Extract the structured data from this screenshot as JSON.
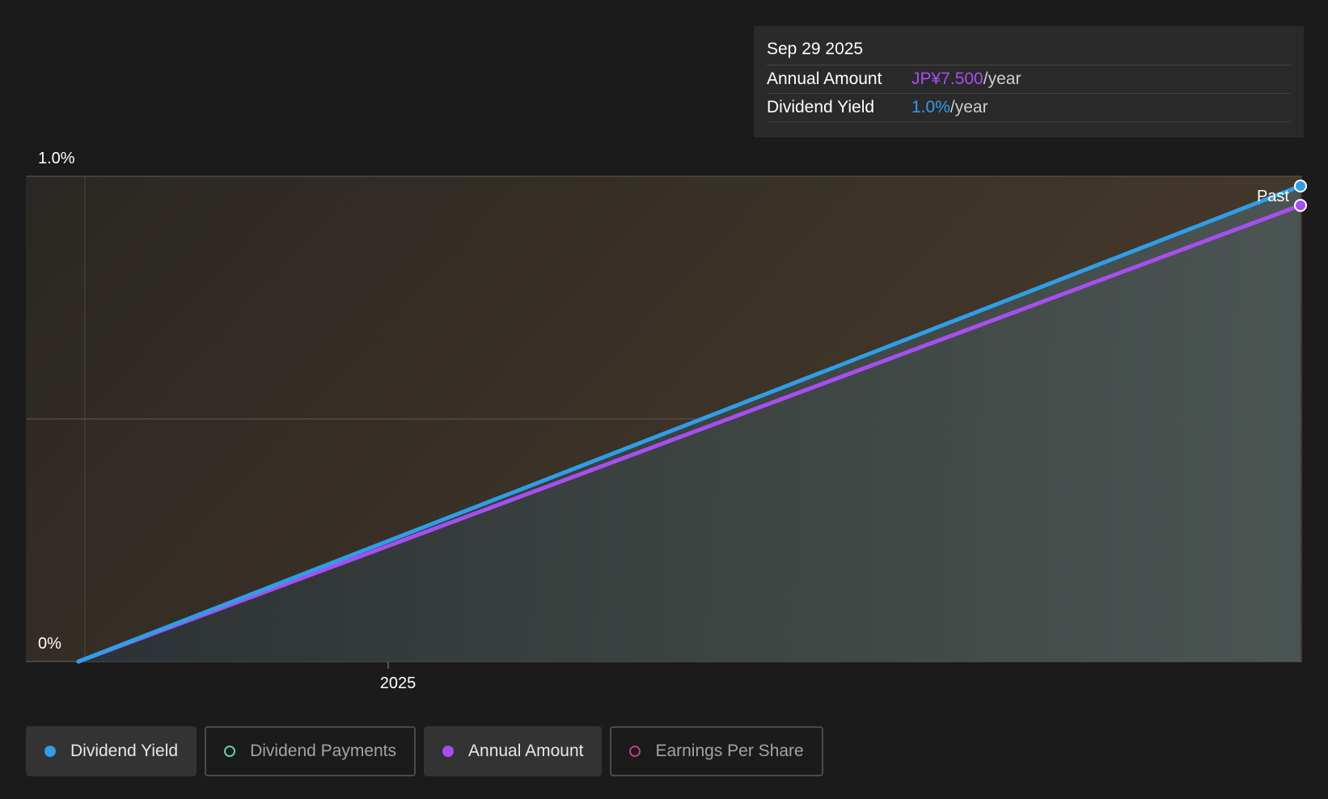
{
  "tooltip": {
    "date": "Sep 29 2025",
    "rows": [
      {
        "label": "Annual Amount",
        "value": "JP¥7.500",
        "unit": "/year"
      },
      {
        "label": "Dividend Yield",
        "value": "1.0%",
        "unit": "/year"
      }
    ]
  },
  "past_label": "Past",
  "legend": [
    {
      "label": "Dividend Yield",
      "active": true,
      "color": "#2f9ee6"
    },
    {
      "label": "Dividend Payments",
      "active": false,
      "color": "#5fcfb7"
    },
    {
      "label": "Annual Amount",
      "active": true,
      "color": "#a64ff0"
    },
    {
      "label": "Earnings Per Share",
      "active": false,
      "color": "#c23d7d"
    }
  ],
  "chart_data": {
    "type": "line",
    "x_labels": [
      "2025"
    ],
    "y_tick_labels": [
      "1.0%",
      "0%"
    ],
    "ylim": [
      0,
      1.0
    ],
    "y_unit": "%",
    "grid": true,
    "series": [
      {
        "name": "Dividend Yield",
        "color": "#2f9ee6",
        "points": [
          {
            "date": "2024-10-01",
            "value": 0.0
          },
          {
            "date": "2025-09-29",
            "value": 0.98
          }
        ]
      },
      {
        "name": "Annual Amount",
        "color": "#a64ff0",
        "points": [
          {
            "date": "2024-10-01",
            "value": 0.0
          },
          {
            "date": "2025-09-29",
            "value": 0.94
          }
        ]
      }
    ]
  }
}
